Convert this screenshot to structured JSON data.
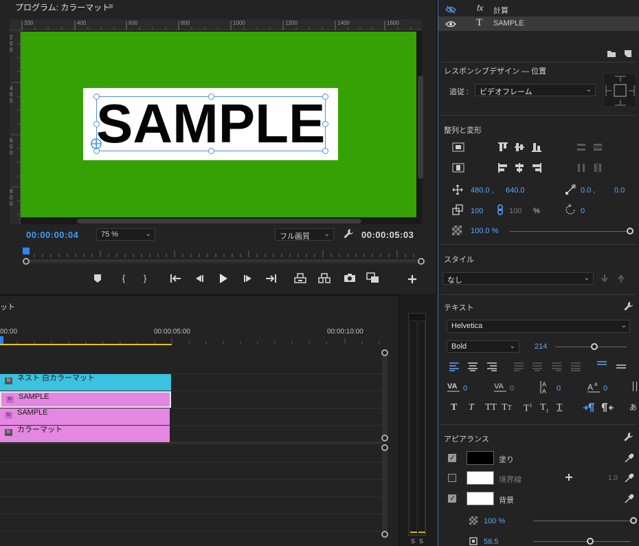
{
  "program": {
    "title": "プログラム: カラーマット",
    "menu_icon": "≡",
    "ruler_top": [
      "200",
      "400",
      "600",
      "800",
      "1000",
      "1200",
      "1400",
      "1600"
    ],
    "ruler_left": [
      "2\n0\n0",
      "4\n0\n0",
      "6\n0\n0",
      "8\n0\n0"
    ],
    "canvas_text": "SAMPLE",
    "timecode_current": "00:00:00:04",
    "zoom": "75 %",
    "quality": "フル画質",
    "timecode_duration": "00:00:05:03",
    "colors": {
      "canvas_bg": "#36a104",
      "timecode_blue": "#3aa0ff"
    }
  },
  "transport": {
    "icons": [
      "marker-icon",
      "mark-in-icon",
      "mark-out-icon",
      "go-to-in-icon",
      "step-back-icon",
      "play-icon",
      "step-forward-icon",
      "go-to-out-icon",
      "lift-icon",
      "extract-icon",
      "export-frame-icon",
      "compare-icon",
      "add-button-icon"
    ]
  },
  "timeline": {
    "title": "ット",
    "times": [
      "00:00",
      "00:00:05:00",
      "00:00:10:00"
    ],
    "clips": [
      {
        "label": "ネスト 白カラーマット",
        "color": "#3ac2e0"
      },
      {
        "label": "SAMPLE",
        "color": "#e487e0"
      },
      {
        "label": "SAMPLE",
        "color": "#e487e0"
      },
      {
        "label": "カラーマット",
        "color": "#e487e0"
      }
    ]
  },
  "meter": {
    "labels": [
      "S",
      "S"
    ]
  },
  "panel": {
    "layers": [
      {
        "name": "計算"
      },
      {
        "name": "SAMPLE"
      }
    ],
    "responsive": {
      "title": "レスポンシブデザイン — 位置",
      "follow_label": "追従 :",
      "follow_value": "ビデオフレーム"
    },
    "align": {
      "title": "整列と変形",
      "position_x": "480.0 ,",
      "position_y": "640.0",
      "anchor_x": "0.0 ,",
      "anchor_y": "0.0",
      "scale": "100",
      "scale_linked": "100",
      "scale_unit": "%",
      "rotation": "0",
      "opacity": "100.0 %"
    },
    "style": {
      "title": "スタイル",
      "value": "なし"
    },
    "text": {
      "title": "テキスト",
      "font": "Helvetica",
      "weight": "Bold",
      "size": "214",
      "kerning": "0",
      "tracking": "0",
      "leading": "0",
      "baseline": "0"
    },
    "appearance": {
      "title": "アピアランス",
      "fill_label": "塗り",
      "stroke_label": "境界線",
      "stroke_width": "1.0",
      "bg_label": "背景",
      "bg_opacity": "100 %",
      "bg_size": "58.5"
    }
  }
}
